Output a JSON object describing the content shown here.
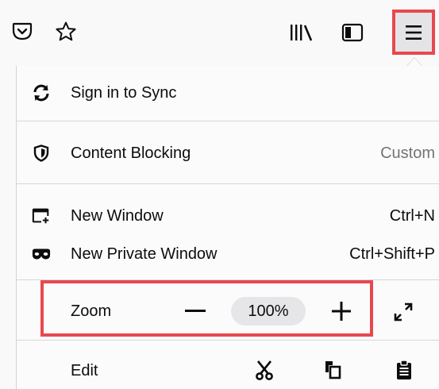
{
  "toolbar": {
    "buttons": [
      {
        "name": "pocket-icon"
      },
      {
        "name": "bookmark-star-icon"
      },
      {
        "name": "library-icon"
      },
      {
        "name": "sidebar-icon"
      },
      {
        "name": "hamburger-menu-icon"
      }
    ]
  },
  "menu": {
    "sync": {
      "label": "Sign in to Sync",
      "icon": "sync-icon"
    },
    "content_blocking": {
      "label": "Content Blocking",
      "value": "Custom",
      "icon": "shield-icon"
    },
    "new_window": {
      "label": "New Window",
      "shortcut": "Ctrl+N",
      "icon": "new-window-icon"
    },
    "new_private_window": {
      "label": "New Private Window",
      "shortcut": "Ctrl+Shift+P",
      "icon": "private-mask-icon"
    },
    "zoom": {
      "label": "Zoom",
      "value": "100%"
    },
    "edit": {
      "label": "Edit"
    }
  },
  "colors": {
    "highlight": "#e8484d",
    "menu_bg": "#fbfbfb",
    "pill_bg": "#e6e6e8"
  }
}
